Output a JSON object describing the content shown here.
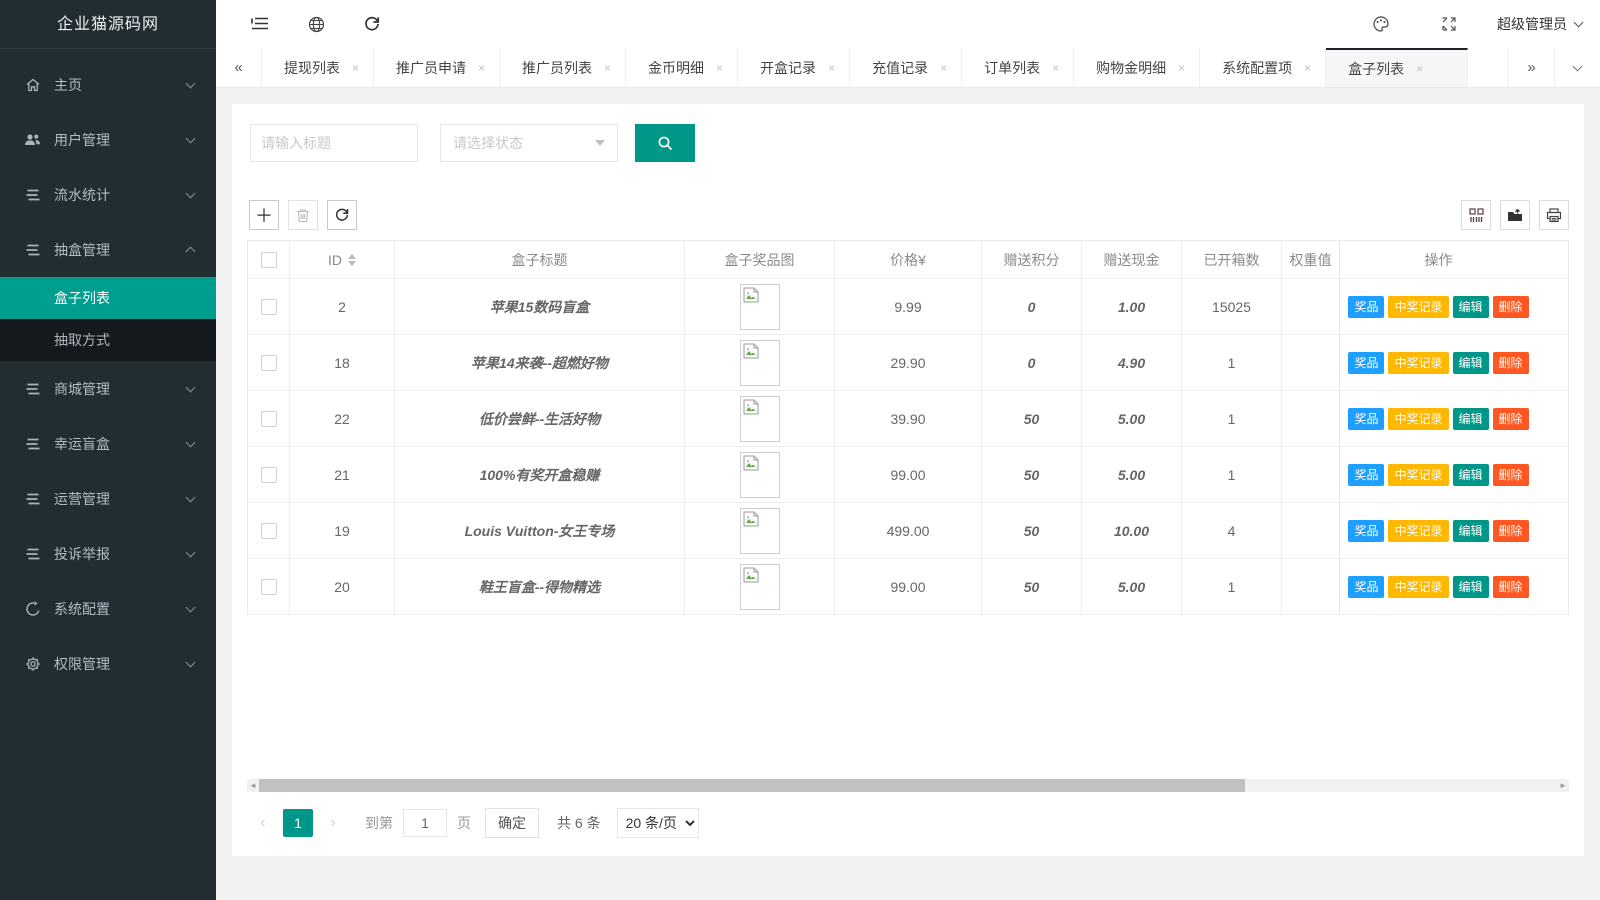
{
  "app": {
    "title": "企业猫源码网"
  },
  "header": {
    "user_name": "超级管理员"
  },
  "sidebar": {
    "items": [
      {
        "key": "home",
        "label": "主页",
        "icon": "home-icon"
      },
      {
        "key": "users",
        "label": "用户管理",
        "icon": "users-icon"
      },
      {
        "key": "flow",
        "label": "流水统计",
        "icon": "list-icon"
      },
      {
        "key": "box-mgmt",
        "label": "抽盒管理",
        "icon": "list-icon",
        "expanded": true,
        "children": [
          {
            "key": "box-list",
            "label": "盒子列表",
            "active": true
          },
          {
            "key": "draw-mode",
            "label": "抽取方式"
          }
        ]
      },
      {
        "key": "mall",
        "label": "商城管理",
        "icon": "list-icon"
      },
      {
        "key": "lucky",
        "label": "幸运盲盒",
        "icon": "list-icon"
      },
      {
        "key": "operation",
        "label": "运营管理",
        "icon": "list-icon"
      },
      {
        "key": "complaint",
        "label": "投诉举报",
        "icon": "list-icon"
      },
      {
        "key": "sysconf",
        "label": "系统配置",
        "icon": "clock-icon"
      },
      {
        "key": "perm",
        "label": "权限管理",
        "icon": "gear-icon"
      }
    ]
  },
  "tabs": {
    "items": [
      {
        "label": "提现列表"
      },
      {
        "label": "推广员申请"
      },
      {
        "label": "推广员列表"
      },
      {
        "label": "金币明细"
      },
      {
        "label": "开盒记录"
      },
      {
        "label": "充值记录"
      },
      {
        "label": "订单列表"
      },
      {
        "label": "购物金明细"
      },
      {
        "label": "系统配置项"
      },
      {
        "label": "盒子列表",
        "active": true
      }
    ]
  },
  "filters": {
    "title_placeholder": "请输入标题",
    "status_placeholder": "请选择状态"
  },
  "table": {
    "headers": {
      "id": "ID",
      "title": "盒子标题",
      "image": "盒子奖品图",
      "price": "价格¥",
      "points": "赠送积分",
      "cash": "赠送现金",
      "opened": "已开箱数",
      "weight": "权重值",
      "actions": "操作"
    },
    "action_labels": [
      "奖品",
      "中奖记录",
      "编辑",
      "删除"
    ],
    "rows": [
      {
        "id": "2",
        "title": "苹果15数码盲盒",
        "price": "9.99",
        "points": "0",
        "cash": "1.00",
        "opened": "15025"
      },
      {
        "id": "18",
        "title": "苹果14来袭--超燃好物",
        "price": "29.90",
        "points": "0",
        "cash": "4.90",
        "opened": "1"
      },
      {
        "id": "22",
        "title": "低价尝鲜--生活好物",
        "price": "39.90",
        "points": "50",
        "cash": "5.00",
        "opened": "1"
      },
      {
        "id": "21",
        "title": "100%有奖开盒稳赚",
        "price": "99.00",
        "points": "50",
        "cash": "5.00",
        "opened": "1"
      },
      {
        "id": "19",
        "title": "Louis Vuitton-女王专场",
        "price": "499.00",
        "points": "50",
        "cash": "10.00",
        "opened": "4"
      },
      {
        "id": "20",
        "title": "鞋王盲盒--得物精选",
        "price": "99.00",
        "points": "50",
        "cash": "5.00",
        "opened": "1"
      }
    ]
  },
  "pagination": {
    "current": "1",
    "goto_label": "到第",
    "goto_value": "1",
    "page_unit": "页",
    "confirm_label": "确定",
    "total_label": "共 6 条",
    "page_size_label": "20 条/页"
  },
  "colors": {
    "accent": "#009688",
    "sidebar_bg": "#222d32",
    "action_blue": "#1E9FFF",
    "action_yellow": "#FFB800",
    "action_green": "#009688",
    "action_red": "#FF5722"
  }
}
